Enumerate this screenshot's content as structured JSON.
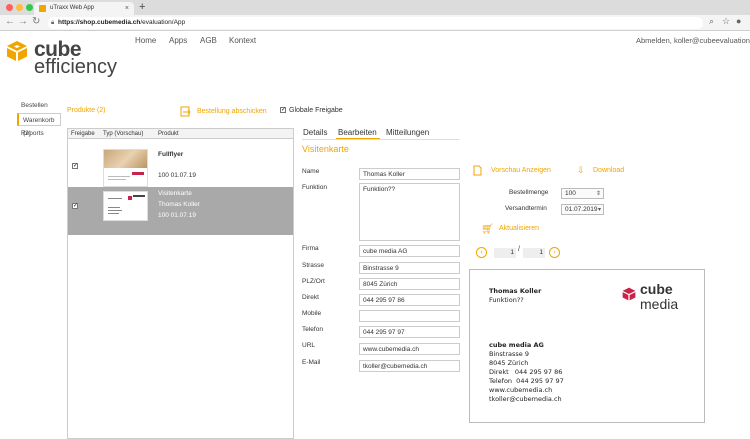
{
  "browser": {
    "tab_title": "uTraxx Web App",
    "tab_close": "×",
    "new_tab": "+",
    "url_host": "https://shop.cubemedia.ch",
    "url_path": "/evaluation/App"
  },
  "header": {
    "logo_line1": "cube",
    "logo_line2": "efficiency",
    "nav": [
      "Home",
      "Apps",
      "AGB",
      "Kontext"
    ],
    "user_link": "Abmelden, koller@cubeevaluation.c"
  },
  "sidebar": {
    "items": [
      {
        "label": "Bestellen"
      },
      {
        "label": "Warenkorb (2)"
      },
      {
        "label": "Reports"
      }
    ]
  },
  "products": {
    "title": "Produkte (2)",
    "order_button": "Bestellung abschicken",
    "global_release_label": "Globale Freigabe",
    "columns": [
      "Freigabe",
      "Typ (Vorschau)",
      "Produkt"
    ],
    "rows": [
      {
        "name": "Fullflyer",
        "code": "100 01.07.19",
        "checked": "✓"
      },
      {
        "name": "Visitenkarte",
        "sub": "Thomas Koller",
        "code": "100 01.07.19",
        "checked": "✓"
      }
    ]
  },
  "tabs": [
    "Details",
    "Bearbeiten",
    "Mitteilungen"
  ],
  "form": {
    "section_title": "Visitenkarte",
    "fields": [
      {
        "label": "Name",
        "value": "Thomas Koller"
      },
      {
        "label": "Funktion",
        "value": "Funktion??"
      },
      {
        "label": "Firma",
        "value": "cube media AG"
      },
      {
        "label": "Strasse",
        "value": "Binstrasse 9"
      },
      {
        "label": "PLZ/Ort",
        "value": "8045 Zürich"
      },
      {
        "label": "Direkt",
        "value": "044 295 97 86"
      },
      {
        "label": "Mobile",
        "value": ""
      },
      {
        "label": "Telefon",
        "value": "044 295 97 97"
      },
      {
        "label": "URL",
        "value": "www.cubemedia.ch"
      },
      {
        "label": "E-Mail",
        "value": "tkoller@cubemedia.ch"
      }
    ]
  },
  "actions": {
    "preview": "Vorschau Anzeigen",
    "download": "Download",
    "quantity_label": "Bestellmenge",
    "quantity_value": "100",
    "delivery_label": "Versandtermin",
    "delivery_value": "01.07.2019",
    "update": "Aktualisieren"
  },
  "pager": {
    "current": "1",
    "separator": "/",
    "total": "1"
  },
  "card": {
    "name": "Thomas Koller",
    "function": "Funktion??",
    "logo_top": "cube",
    "logo_bottom": "media",
    "company": "cube media AG",
    "lines": [
      "Binstrasse 9",
      "8045 Zürich",
      "Direkt   044 295 97 86",
      "Telefon  044 295 97 97",
      "www.cubemedia.ch",
      "tkoller@cubemedia.ch"
    ]
  },
  "colors": {
    "accent": "#f0a500",
    "brand_red": "#c8234a"
  }
}
